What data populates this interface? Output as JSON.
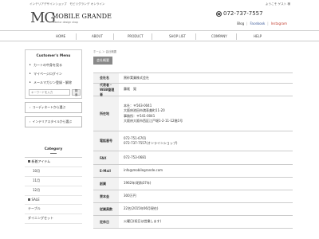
{
  "header": {
    "tagline": "インテリアデザインショップ　モビリグランデ オンライン",
    "welcome": "ようこそ ゲスト 様",
    "logo_mark": "MG",
    "logo_name": "MOBILE GRANDE",
    "logo_sub": "interior design shop",
    "phone": "072-737-7557",
    "sublinks": {
      "blog": "Blog",
      "facebook": "Facebook",
      "instagram": "Instagram"
    }
  },
  "nav": [
    "HOME",
    "ABOUT",
    "PRODUCT",
    "SHOP LIST",
    "COMPANY",
    "HELP"
  ],
  "sidebar": {
    "customer_title": "Customer's Menu",
    "menu": [
      {
        "label": "カートの中身を見る"
      },
      {
        "label": "マイページログイン"
      },
      {
        "label": "メールマガジン登録・解除"
      }
    ],
    "search_placeholder": "キーワードを入力",
    "search_button": "検索",
    "banners": [
      "コーディネートから選ぶ",
      "インテリアスタイルから選ぶ"
    ],
    "category_title": "Category",
    "categories": [
      {
        "label": "新着アイテム",
        "kind": "square"
      },
      {
        "label": "10月",
        "kind": "sub"
      },
      {
        "label": "11月",
        "kind": "sub"
      },
      {
        "label": "12月",
        "kind": "sub"
      },
      {
        "label": "SALE",
        "kind": "square"
      },
      {
        "label": "テーブル",
        "kind": "plain"
      },
      {
        "label": "ダイニングセット",
        "kind": "plain"
      }
    ]
  },
  "main": {
    "breadcrumb": "ホーム ＞ 会社概要",
    "page_label": "会社概要",
    "rows": [
      {
        "key": "会社名",
        "lines": [
          "黒砂実業株式会社"
        ]
      },
      {
        "key": "代表者・WEB管理者",
        "lines": [
          "藤尾　晃"
        ]
      },
      {
        "key": "所在地",
        "lines": [
          "本社：〒563-0041",
          "大阪府池田市満寿美町11-20",
          "事務所：〒541-0041",
          "大阪府大阪市西区江戸堀1-2-11-12階1号"
        ]
      },
      {
        "key": "電話番号",
        "lines": [
          "072-751-6701",
          "072-737-7557(オンラインショップ)"
        ]
      },
      {
        "key": "FAX",
        "lines": [
          "072-753-0681"
        ]
      },
      {
        "key": "E-Mail",
        "lines": [
          "info@mobilegrande.com"
        ]
      },
      {
        "key": "創業",
        "lines": [
          "1962年(昭和37年)"
        ]
      },
      {
        "key": "資本金",
        "lines": [
          "300万円"
        ]
      },
      {
        "key": "従業員数",
        "lines": [
          "22名(2015年06月現在)"
        ]
      },
      {
        "key": "定休日",
        "lines": [
          "火曜日(祝日は営業します)"
        ]
      }
    ]
  }
}
